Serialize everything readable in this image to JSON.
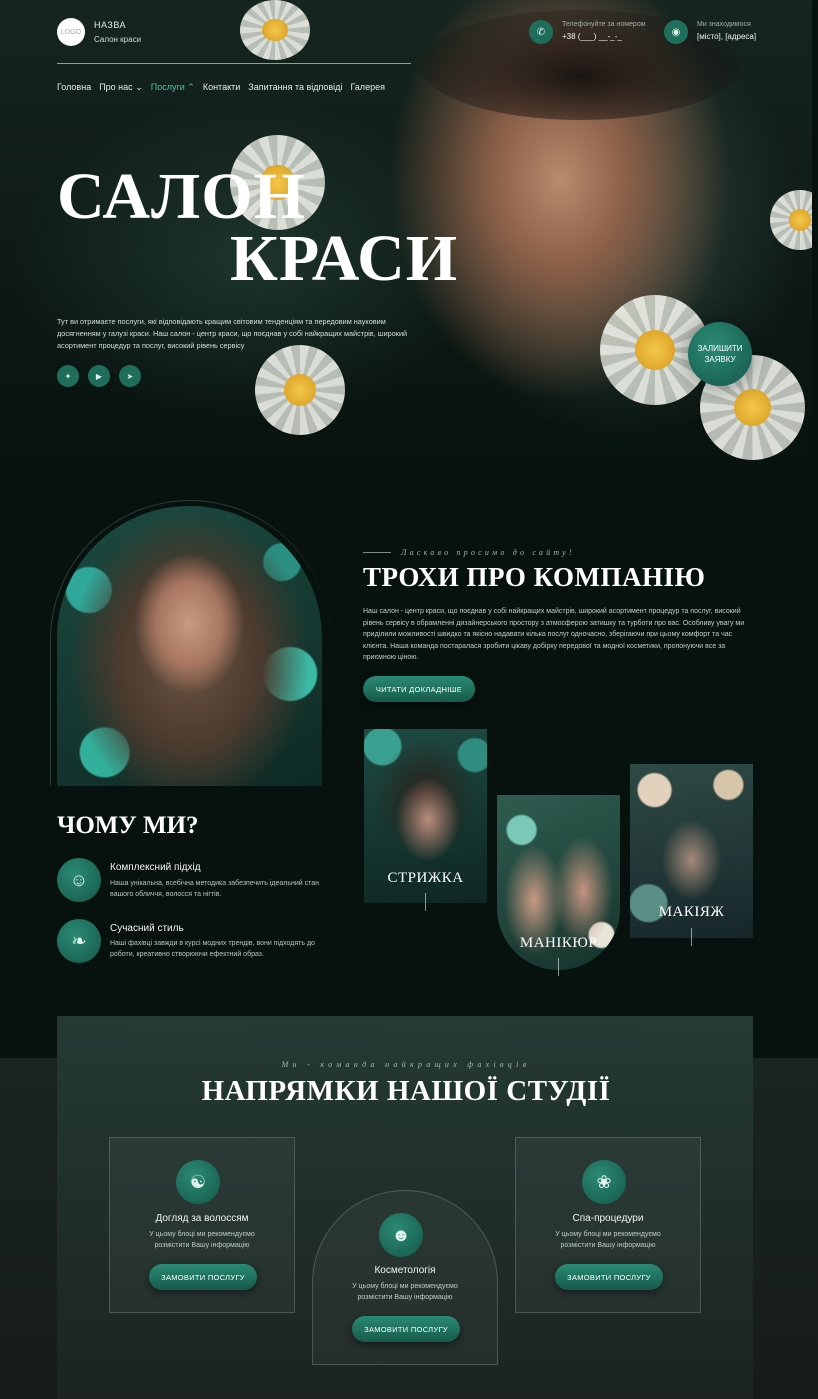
{
  "header": {
    "logo": "LOGO",
    "brand_name": "НАЗВА",
    "brand_sub": "Салон краси",
    "phone_label": "Телефонуйте за номером",
    "phone_value": "+38 (___) __-_-_",
    "location_label": "Ми знаходимося",
    "location_value": "[місто], [адреса]"
  },
  "nav": {
    "items": [
      "Головна",
      "Про нас",
      "Послуги",
      "Контакти",
      "Запитання та відповіді",
      "Галерея"
    ],
    "active": "Послуги"
  },
  "hero": {
    "title_line1": "САЛОН",
    "title_line2": "КРАСИ",
    "text": "Тут ви отримаєте послуги, які відповідають кращим світовим тенденціям та передовим науковим досягненням у галузі краси. Наш салон - центр краси, що поєднав у собі найкращих майстрів, широкий асортимент процедур та послуг, високий рівень сервісу",
    "cta": "ЗАЛИШИТИ ЗАЯВКУ",
    "socials": [
      "twitter-icon",
      "youtube-icon",
      "telegram-icon"
    ]
  },
  "about": {
    "welcome": "Ласкаво просимо до сайту!",
    "title": "ТРОХИ ПРО КОМПАНІЮ",
    "text": "Наш салон - центр краси, що поєднав у собі найкращих майстрів, широкий асортимент процедур та послуг, високий рівень сервісу в обрамленні дизайнерського простору з атмосферою затишку та турботи про вас. Особливу увагу ми приділили можливості швидко та якісно надавати кілька послуг одночасно, зберігаючи при цьому комфорт та час клієнта. Наша команда постаралася зробити цікаву добірку передової та модної косметики, пропонуючи все за приємною ціною.",
    "button": "ЧИТАТИ ДОКЛАДНІШЕ",
    "cards": [
      "СТРИЖКА",
      "МАНІКЮР",
      "МАКІЯЖ"
    ]
  },
  "why": {
    "title": "ЧОМУ МИ?",
    "features": [
      {
        "title": "Комплексний підхід",
        "text": "Наша унікальна, всебічна методика забезпечить ідеальний стан вашого обличчя, волосся та нігтів.",
        "icon": "face-icon"
      },
      {
        "title": "Сучасний стиль",
        "text": "Наші фахівці завжди в курсі модних трендів, вони підходять до роботи, креативно створюючи ефектний образ.",
        "icon": "hair-icon"
      }
    ]
  },
  "services": {
    "team": "Ми - команда найкращих фахівців",
    "title": "НАПРЯМКИ НАШОЇ СТУДІЇ",
    "items": [
      {
        "name": "Догляд за волоссям",
        "text": "У цьому блоці ми рекомендуємо розмістити Вашу інформацію",
        "button": "ЗАМОВИТИ ПОСЛУГУ",
        "icon": "hair-care-icon"
      },
      {
        "name": "Косметологія",
        "text": "У цьому блоці ми рекомендуємо розмістити Вашу інформацію",
        "button": "ЗАМОВИТИ ПОСЛУГУ",
        "icon": "cosmetology-icon"
      },
      {
        "name": "Спа-процедури",
        "text": "У цьому блоці ми рекомендуємо розмістити Вашу інформацію",
        "button": "ЗАМОВИТИ ПОСЛУГУ",
        "icon": "spa-icon"
      }
    ]
  },
  "colors": {
    "accent": "#1f6e5c",
    "active_nav": "#49c2a7",
    "background": "#07120e"
  }
}
